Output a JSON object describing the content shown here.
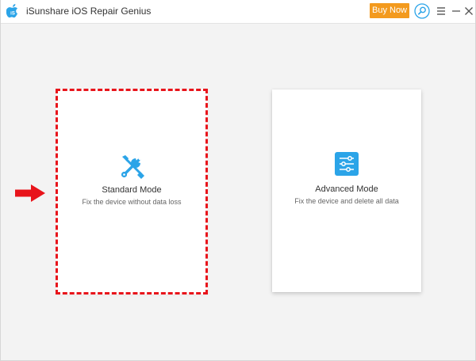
{
  "app": {
    "title": "iSunshare iOS Repair Genius",
    "buy_label": "Buy Now",
    "accent": "#f39a1e",
    "brand": "#2ba4e8"
  },
  "titlebar_icons": [
    "apple-logo-icon",
    "search-icon",
    "menu-icon",
    "minimize-icon",
    "close-icon"
  ],
  "modes": [
    {
      "title": "Standard Mode",
      "description": "Fix the device without data loss",
      "icon": "wrench-screwdriver-icon",
      "highlighted": true,
      "highlight_color": "#e8141b"
    },
    {
      "title": "Advanced Mode",
      "description": "Fix the device and delete all data",
      "icon": "sliders-icon",
      "highlighted": false
    }
  ],
  "pointer": {
    "icon": "red-arrow-icon",
    "color": "#e8141b"
  }
}
